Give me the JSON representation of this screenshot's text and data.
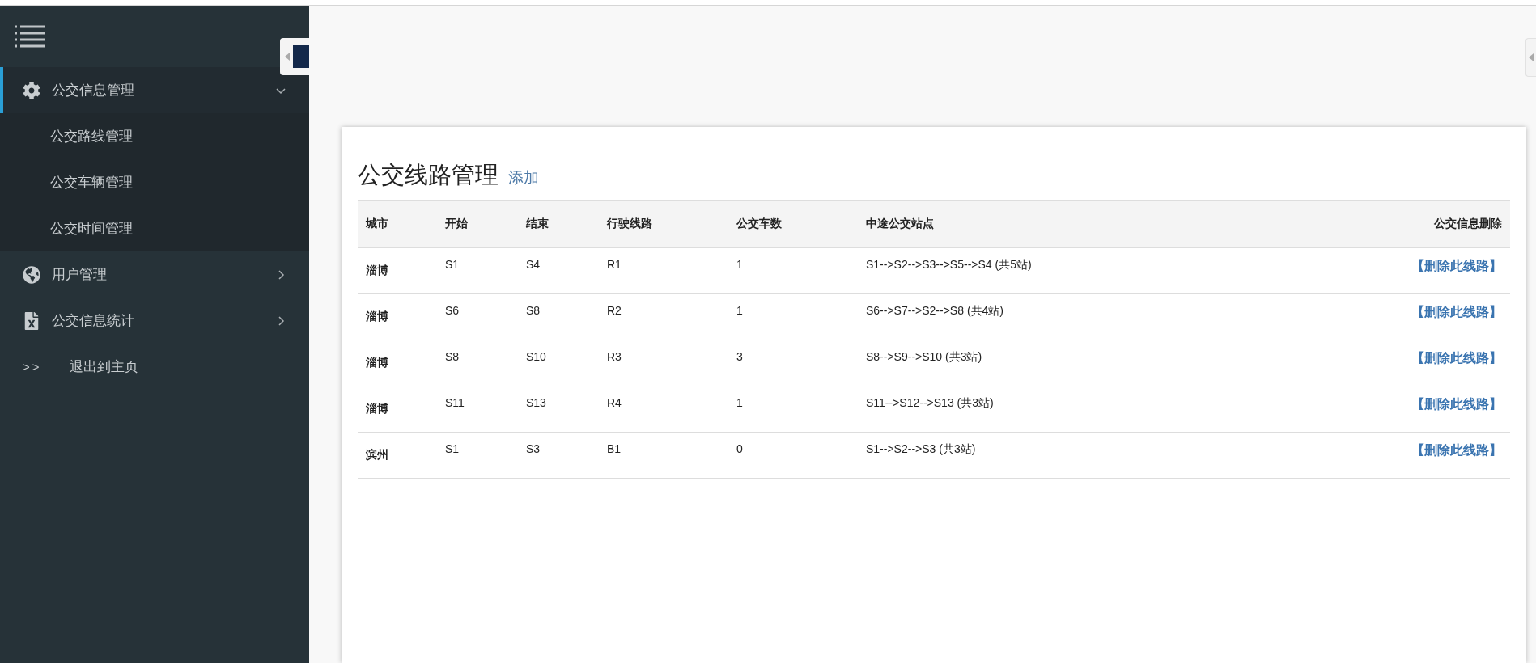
{
  "sidebar": {
    "menu": [
      {
        "kind": "group",
        "label": "公交信息管理",
        "selected": true,
        "expanded": true,
        "children": [
          {
            "label": "公交路线管理"
          },
          {
            "label": "公交车辆管理"
          },
          {
            "label": "公交时间管理"
          }
        ]
      },
      {
        "kind": "group",
        "label": "用户管理",
        "selected": false,
        "expanded": false
      },
      {
        "kind": "group",
        "label": "公交信息统计",
        "selected": false,
        "expanded": false
      },
      {
        "kind": "link",
        "prefix": ">>",
        "label": "退出到主页",
        "selected": false
      }
    ]
  },
  "page": {
    "title": "公交线路管理",
    "add_link": "添加",
    "table": {
      "columns": [
        "城市",
        "开始",
        "结束",
        "行驶线路",
        "公交车数",
        "中途公交站点",
        "公交信息删除"
      ],
      "rows": [
        {
          "city": "淄博",
          "start": "S1",
          "end": "S4",
          "route": "R1",
          "buses": "1",
          "stops": "S1-->S2-->S3-->S5-->S4 (共5站)",
          "action": "【删除此线路】"
        },
        {
          "city": "淄博",
          "start": "S6",
          "end": "S8",
          "route": "R2",
          "buses": "1",
          "stops": "S6-->S7-->S2-->S8 (共4站)",
          "action": "【删除此线路】"
        },
        {
          "city": "淄博",
          "start": "S8",
          "end": "S10",
          "route": "R3",
          "buses": "3",
          "stops": "S8-->S9-->S10 (共3站)",
          "action": "【删除此线路】"
        },
        {
          "city": "淄博",
          "start": "S11",
          "end": "S13",
          "route": "R4",
          "buses": "1",
          "stops": "S11-->S12-->S13 (共3站)",
          "action": "【删除此线路】"
        },
        {
          "city": "滨州",
          "start": "S1",
          "end": "S3",
          "route": "B1",
          "buses": "0",
          "stops": "S1-->S2-->S3 (共3站)",
          "action": "【删除此线路】"
        }
      ]
    }
  }
}
